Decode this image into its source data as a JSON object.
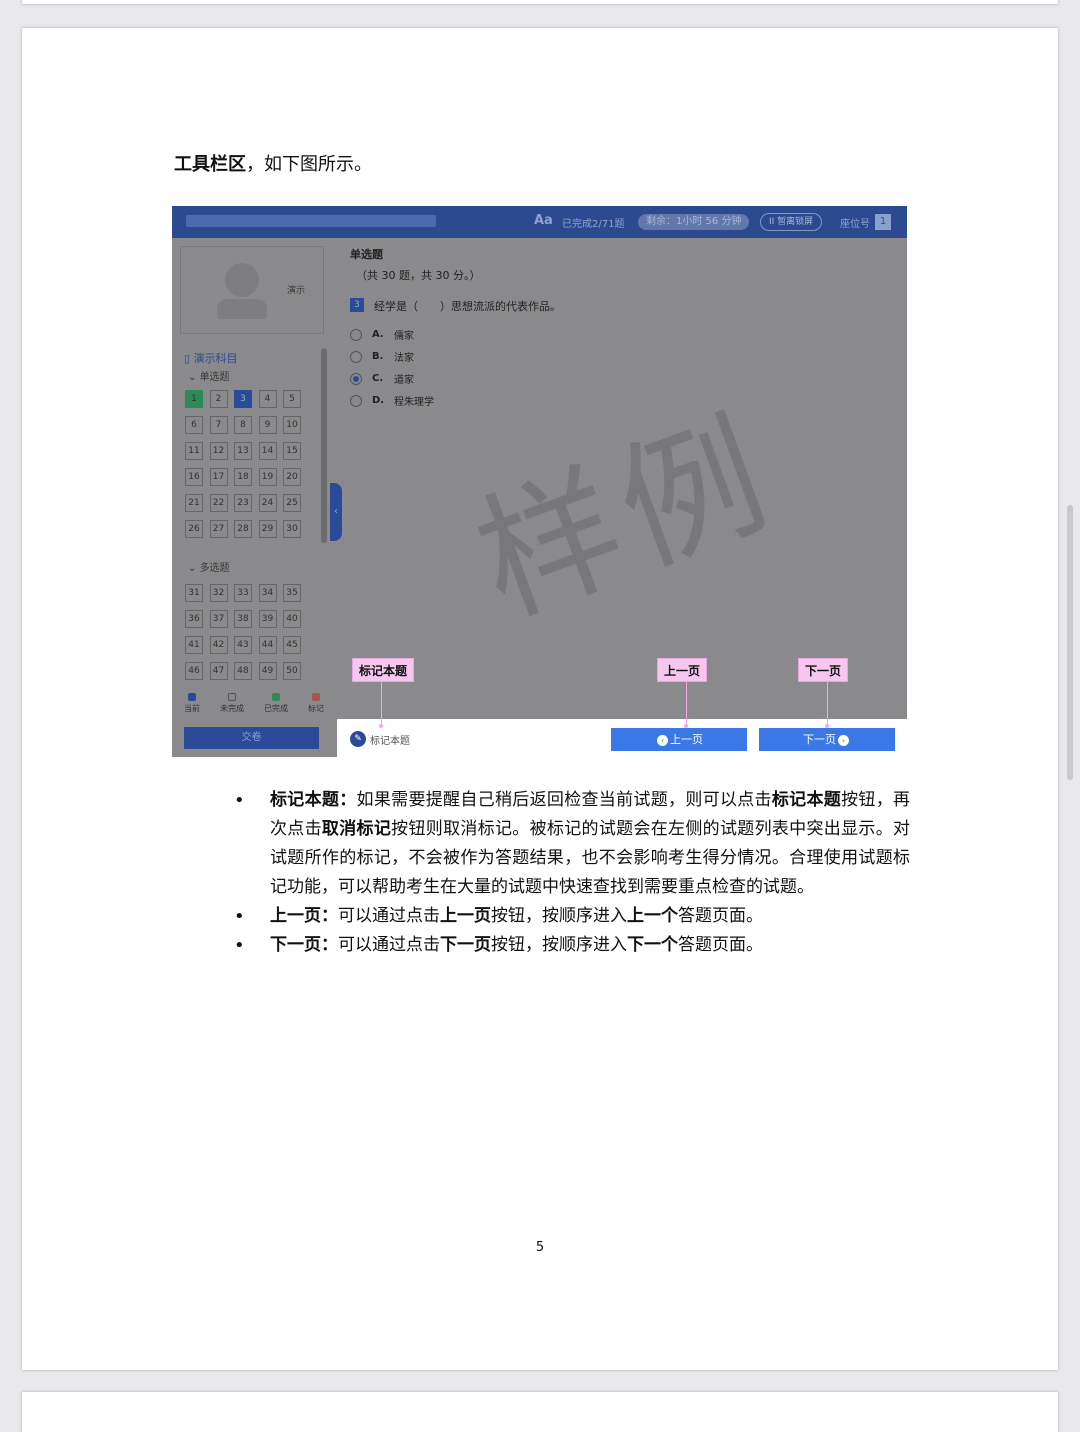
{
  "doc": {
    "heading_bold": "工具栏区",
    "heading_rest": "，如下图所示。",
    "page_number": "5"
  },
  "screenshot": {
    "topbar": {
      "font_icon": "Aa",
      "progress": "已完成2/71题",
      "timer": "剩余：1小时 56 分钟",
      "pause": "II 暂离锁屏",
      "seat_label": "座位号",
      "seat_no": "1"
    },
    "sidebar": {
      "avatar_name": "演示",
      "subject": "演示科目",
      "section1": "单选题",
      "section2": "多选题",
      "grid1": [
        "1",
        "2",
        "3",
        "4",
        "5",
        "6",
        "7",
        "8",
        "9",
        "10",
        "11",
        "12",
        "13",
        "14",
        "15",
        "16",
        "17",
        "18",
        "19",
        "20",
        "21",
        "22",
        "23",
        "24",
        "25",
        "26",
        "27",
        "28",
        "29",
        "30"
      ],
      "grid2": [
        "31",
        "32",
        "33",
        "34",
        "35",
        "36",
        "37",
        "38",
        "39",
        "40",
        "41",
        "42",
        "43",
        "44",
        "45",
        "46",
        "47",
        "48",
        "49",
        "50"
      ],
      "legend": [
        "当前",
        "未完成",
        "已完成",
        "标记"
      ],
      "submit": "交卷"
    },
    "question": {
      "type": "单选题",
      "info": "（共 30 题，共 30 分。）",
      "number": "3",
      "stem": "经学是（　　）思想流派的代表作品。",
      "options": [
        {
          "letter": "A.",
          "text": "儒家"
        },
        {
          "letter": "B.",
          "text": "法家"
        },
        {
          "letter": "C.",
          "text": "道家"
        },
        {
          "letter": "D.",
          "text": "程朱理学"
        }
      ]
    },
    "watermark": "样例",
    "callouts": {
      "mark": "标记本题",
      "prev": "上一页",
      "next": "下一页"
    },
    "toolbar": {
      "mark_button": "标记本题",
      "prev_button": "上一页",
      "next_button": "下一页"
    }
  },
  "bullets": [
    {
      "parts": [
        {
          "b": true,
          "t": "标记本题："
        },
        {
          "b": false,
          "t": "如果需要提醒自己稍后返回检查当前试题，则可以点击"
        },
        {
          "b": true,
          "t": "标记本题"
        },
        {
          "b": false,
          "t": "按钮，再次点击"
        },
        {
          "b": true,
          "t": "取消标记"
        },
        {
          "b": false,
          "t": "按钮则取消标记。被标记的试题会在左侧的试题列表中突出显示。对试题所作的标记，不会被作为答题结果，也不会影响考生得分情况。合理使用试题标记功能，可以帮助考生在大量的试题中快速查找到需要重点检查的试题。"
        }
      ]
    },
    {
      "parts": [
        {
          "b": true,
          "t": "上一页："
        },
        {
          "b": false,
          "t": "可以通过点击"
        },
        {
          "b": true,
          "t": "上一页"
        },
        {
          "b": false,
          "t": "按钮，按顺序进入"
        },
        {
          "b": true,
          "t": "上一个"
        },
        {
          "b": false,
          "t": "答题页面。"
        }
      ]
    },
    {
      "parts": [
        {
          "b": true,
          "t": "下一页："
        },
        {
          "b": false,
          "t": "可以通过点击"
        },
        {
          "b": true,
          "t": "下一页"
        },
        {
          "b": false,
          "t": "按钮，按顺序进入"
        },
        {
          "b": true,
          "t": "下一个"
        },
        {
          "b": false,
          "t": "答题页面。"
        }
      ]
    }
  ]
}
